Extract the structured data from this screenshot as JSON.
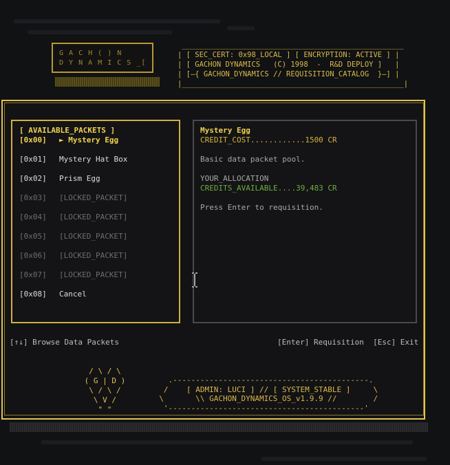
{
  "logo": {
    "line1": "G A C H ( ) N",
    "line2": "D Y N A M I C S _[ ]"
  },
  "banner": {
    "lines": [
      " ___________________________________________________",
      "| [ SEC_CERT: 0x98_LOCAL ] [ ENCRYPTION: ACTIVE ] |",
      "| [ GACHON DYNAMICS   (C) 1998  -  R&D DEPLOY ]   |",
      "| [—{ GACHON_DYNAMICS // REQUISITION_CATALOG  }—] |",
      "|___________________________________________________|"
    ]
  },
  "catalog": {
    "header": "[ AVAILABLE_PACKETS ]",
    "items": [
      {
        "code": "[0x00]",
        "label": "► Mystery Egg",
        "state": "selected"
      },
      {
        "code": "[0x01]",
        "label": "Mystery Hat Box",
        "state": "available"
      },
      {
        "code": "[0x02]",
        "label": "Prism Egg",
        "state": "available"
      },
      {
        "code": "[0x03]",
        "label": "[LOCKED_PACKET]",
        "state": "locked"
      },
      {
        "code": "[0x04]",
        "label": "[LOCKED_PACKET]",
        "state": "locked"
      },
      {
        "code": "[0x05]",
        "label": "[LOCKED_PACKET]",
        "state": "locked"
      },
      {
        "code": "[0x06]",
        "label": "[LOCKED_PACKET]",
        "state": "locked"
      },
      {
        "code": "[0x07]",
        "label": "[LOCKED_PACKET]",
        "state": "locked"
      },
      {
        "code": "[0x08]",
        "label": "Cancel",
        "state": "available"
      }
    ]
  },
  "detail": {
    "title": "Mystery Egg",
    "cost": "CREDIT_COST............1500 CR",
    "description": "Basic data packet pool.",
    "allocation_label": "YOUR_ALLOCATION",
    "credits": "CREDITS_AVAILABLE....39,483 CR",
    "prompt": "Press Enter to requisition."
  },
  "hints": {
    "browse": "[↑↓] Browse Data Packets",
    "actions": "[Enter] Requisition  [Esc] Exit"
  },
  "footer": {
    "art": [
      "  / \\ / \\",
      " ( G | D )",
      "  \\ / \\ /",
      "   \\ V /",
      "    \" \""
    ],
    "box": [
      "    .-------------------------------------------.",
      "   /    [ ADMIN: LUCI ] // [ SYSTEM_STABLE ]     \\",
      "  \\       \\\\ GACHON_DYNAMICS_OS_v1.9.9 //        /",
      "   '-------------------------------------------'"
    ]
  },
  "colors": {
    "accent": "#e3c24f",
    "selected": "#f0d24f",
    "locked": "#6d6d6d",
    "credits": "#6cae3e",
    "background": "#111214"
  }
}
